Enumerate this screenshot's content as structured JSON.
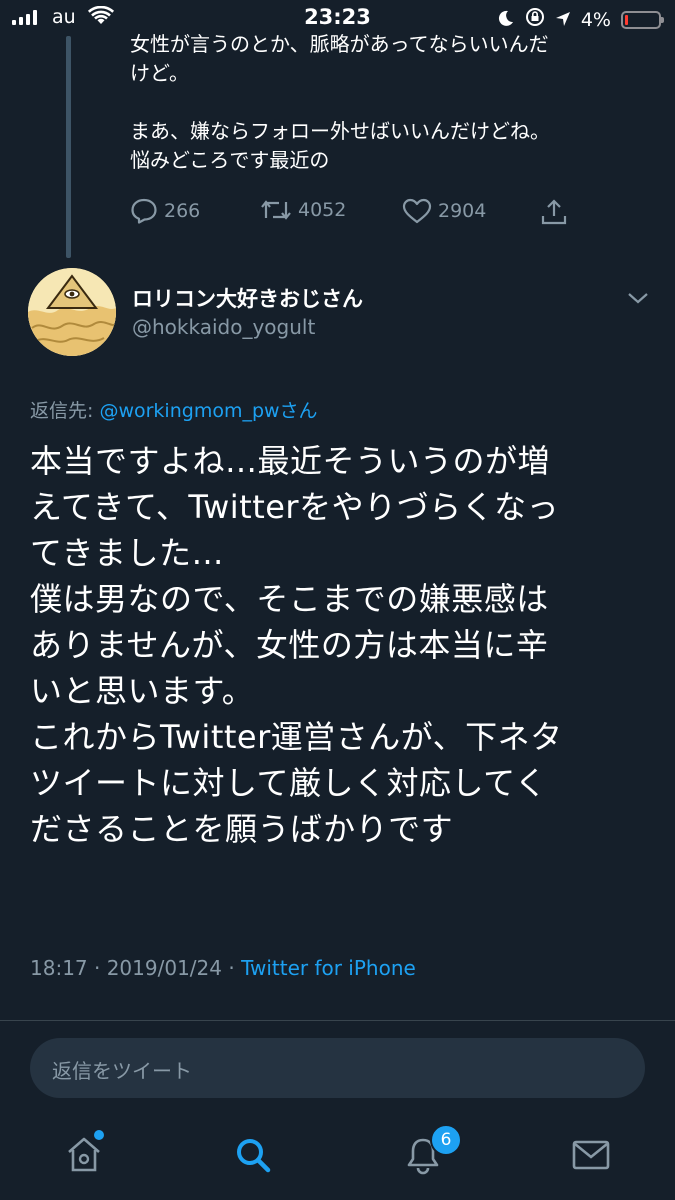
{
  "status_bar": {
    "carrier": "au",
    "time": "23:23",
    "battery_percent": "4%",
    "icons": [
      "signal-icon",
      "wifi-icon",
      "moon-icon",
      "rotation-lock-icon",
      "location-icon",
      "battery-icon"
    ],
    "battery_level": 0.04
  },
  "previous_tweet": {
    "text": "女性が言うのとか、脈略があってならいいんだ\nけど。\n\nまあ、嫌ならフォロー外せばいいんだけどね。\n悩みどころです最近の",
    "replies": "266",
    "retweets": "4052",
    "likes": "2904"
  },
  "tweet": {
    "display_name": "ロリコン大好きおじさん",
    "handle": "@hokkaido_yogult",
    "replying_prefix": "返信先: ",
    "replying_to": "@workingmom_pwさん",
    "text": "本当ですよね…最近そういうのが増\nえてきて、Twitterをやりづらくなっ\nてきました…\n僕は男なので、そこまでの嫌悪感は\nありませんが、女性の方は本当に辛\nいと思います。\nこれからTwitter運営さんが、下ネタ\nツイートに対して厳しく対応してく\nださることを願うばかりです",
    "time": "18:17 · 2019/01/24 · ",
    "source": "Twitter for iPhone"
  },
  "reply_box": {
    "placeholder": "返信をツイート"
  },
  "tab_bar": {
    "notifications_badge": "6",
    "tabs": [
      "home-icon",
      "search-icon",
      "notifications-icon",
      "messages-icon"
    ]
  },
  "colors": {
    "background": "#151f2a",
    "accent": "#1da1f2",
    "secondary_text": "#8899a6"
  }
}
